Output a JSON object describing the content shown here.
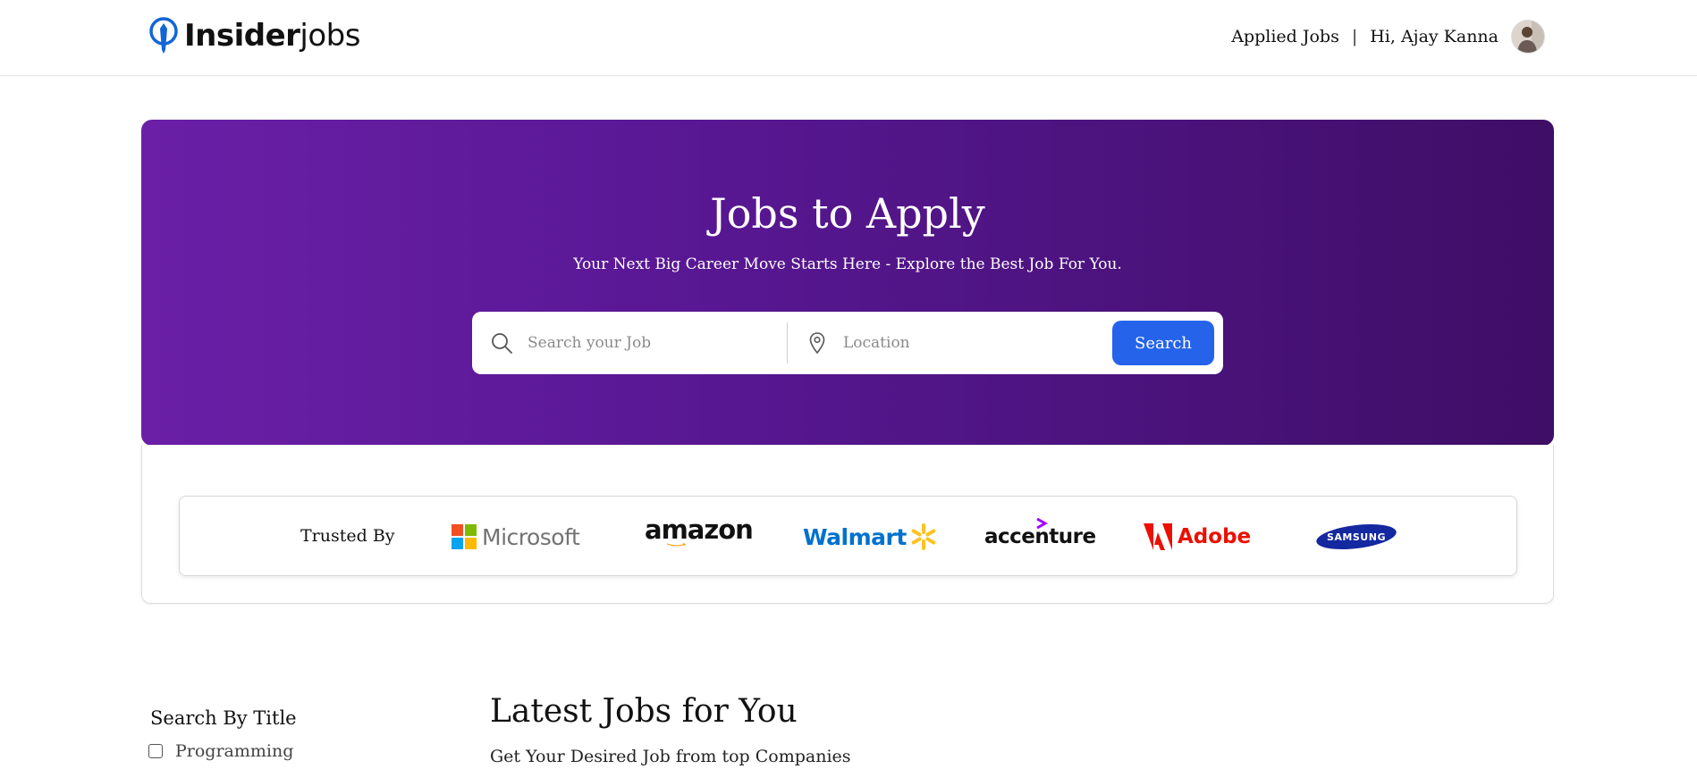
{
  "navbar": {
    "logo_bold": "Insider",
    "logo_light": "jobs",
    "applied_jobs_label": "Applied Jobs",
    "separator": "|",
    "greeting": "Hi, Ajay Kanna"
  },
  "hero": {
    "title": "Jobs to Apply",
    "subtitle": "Your Next Big Career Move Starts Here - Explore the Best Job For You.",
    "search_placeholder": "Search your Job",
    "location_placeholder": "Location",
    "search_button_label": "Search"
  },
  "trusted": {
    "label": "Trusted By",
    "brands": [
      {
        "name": "Microsoft",
        "color": "#737373"
      },
      {
        "name": "amazon",
        "color": "#111111"
      },
      {
        "name": "Walmart",
        "color": "#0071ce"
      },
      {
        "name": "accenture",
        "color": "#111111"
      },
      {
        "name": "Adobe",
        "color": "#eb1000"
      },
      {
        "name": "SAMSUNG",
        "color": "#1428a0"
      }
    ]
  },
  "filters": {
    "title": "Search By Title",
    "options": [
      {
        "label": "Programming",
        "checked": false
      }
    ]
  },
  "latest": {
    "title": "Latest Jobs for You",
    "subtitle": "Get Your Desired Job from top Companies"
  },
  "colors": {
    "hero_gradient_start": "#6a1fa6",
    "hero_gradient_end": "#3f0e66",
    "search_button": "#2563eb"
  }
}
